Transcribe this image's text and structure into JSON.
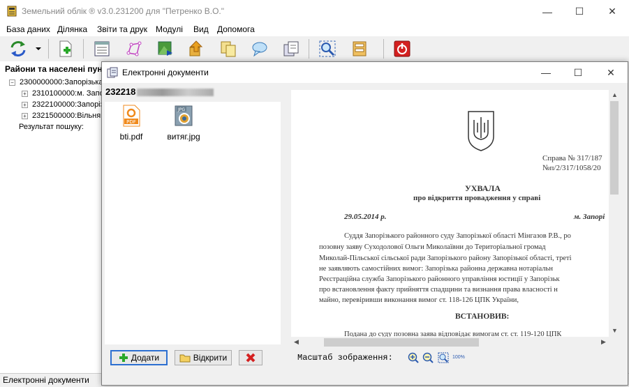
{
  "app": {
    "title": "Земельний облік ® v3.0.231200 для \"Петренко В.О.\"",
    "window_controls": {
      "minimize": "—",
      "maximize": "☐",
      "close": "✕"
    }
  },
  "menu": [
    "База даних",
    "Ділянка",
    "Звіти та друк",
    "Модулі",
    "Вид",
    "Допомога"
  ],
  "toolbar_icons": [
    "sync-icon",
    "dropdown-arrow-icon",
    "new-document-icon",
    "form-icon",
    "polygon-icon",
    "map-export-icon",
    "upload-icon",
    "copy-icon",
    "comment-icon",
    "report-icon",
    "zoom-to-icon",
    "archive-icon",
    "exit-icon"
  ],
  "left_panel": {
    "header": "Райони та населені пун",
    "tree": {
      "root": "2300000000:Запорізька",
      "children": [
        "2310100000:м. Запо",
        "2322100000:Запоріз",
        "2321500000:Вільнян"
      ],
      "search_result": "Результат пошуку:"
    }
  },
  "status_bar": {
    "text": "Електронні документи"
  },
  "dialog": {
    "title": "Електронні документи",
    "code": "232218",
    "files": [
      {
        "name": "bti.pdf",
        "type": "PDF"
      },
      {
        "name": "витяг.jpg",
        "type": "JPG"
      }
    ],
    "buttons": {
      "add": "Додати",
      "open": "Відкрити"
    },
    "zoom_label": "Масштаб зображення:",
    "zoom_100": "100%"
  },
  "document": {
    "case_no": "Справа № 317/187",
    "proc_no": "№п/2/317/1058/20",
    "heading": "УХВАЛА",
    "subheading": "про відкриття провадження у справі",
    "date": "29.05.2014 р.",
    "place": "м. Запорі",
    "body": [
      "Суддя Запорізького районного суду Запорізької області Мінгазов Р.В., ро",
      "позовну заяву Суходолової Ольги Миколаївни до Територіальної громад",
      "Миколай-Пільської сільської ради Запорізького району Запорізької області, треті",
      "не заявляють самостійних вимог: Запорізька районна державна нотаріальн",
      "Реєстраційна служба Запорізького районного управління юстиції у Запорізьк",
      "про встановлення факту прийняття спадщини та визнання права власності н",
      "майно, перевіривши виконання вимог ст. 118-126 ЦПК України,"
    ],
    "established": "ВСТАНОВИВ:",
    "last_line": "Подана до суду позовна заява відповідає вимогам ст. ст. 119-120 ЦПК"
  },
  "colors": {
    "accent": "#2c6fd1",
    "danger": "#d42020",
    "pdf_orange": "#f08a1c"
  }
}
